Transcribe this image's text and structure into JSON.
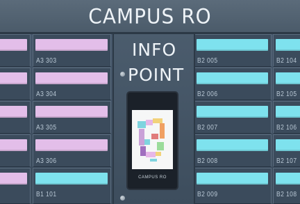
{
  "sign": {
    "title": "CAMPUS RO"
  },
  "info_point": {
    "line1": "INFO",
    "line2": "POINT",
    "kiosk_brand": "CAMPUS RO"
  },
  "columns": {
    "col0": [
      {
        "label_color": "pink"
      },
      {
        "label_color": "pink"
      },
      {
        "label_color": "pink"
      },
      {
        "label_color": "pink"
      },
      {
        "label_color": "pink"
      }
    ],
    "col1": [
      {
        "room": "A3 303",
        "label_color": "pink"
      },
      {
        "room": "A3 304",
        "label_color": "pink"
      },
      {
        "room": "A3 305",
        "label_color": "pink"
      },
      {
        "room": "A3 306",
        "label_color": "pink"
      },
      {
        "room": "B1 101",
        "label_color": "cyan"
      }
    ],
    "col2": [
      {
        "room": "B2 005",
        "label_color": "cyan"
      },
      {
        "room": "B2 006",
        "label_color": "cyan"
      },
      {
        "room": "B2 007",
        "label_color": "cyan"
      },
      {
        "room": "B2 008",
        "label_color": "cyan"
      },
      {
        "room": "B2 009",
        "label_color": "cyan"
      }
    ],
    "col3": [
      {
        "room": "B2 104",
        "label_color": "cyan"
      },
      {
        "room": "B2 105",
        "label_color": "cyan"
      },
      {
        "room": "B2 106",
        "label_color": "cyan"
      },
      {
        "room": "B2 107",
        "label_color": "cyan"
      },
      {
        "room": "B2 108",
        "label_color": "cyan"
      }
    ]
  },
  "colors": {
    "label_pink": "#e3bee9",
    "label_cyan": "#7ee2ee",
    "panel": "#3f4f5f"
  }
}
